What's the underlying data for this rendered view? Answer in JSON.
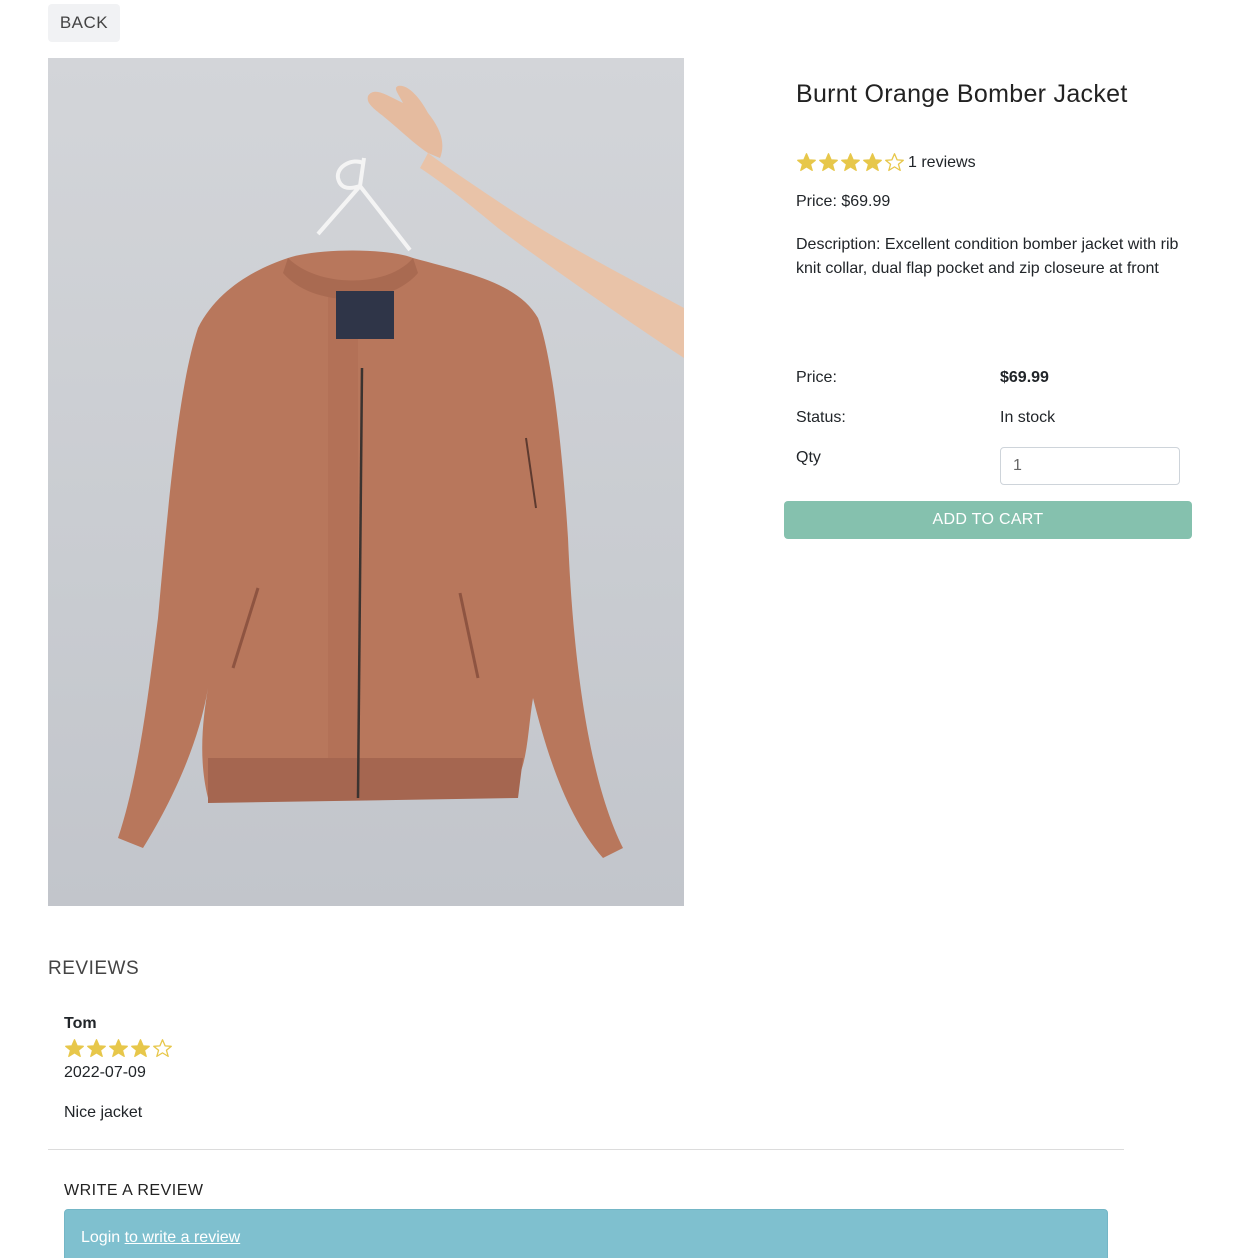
{
  "nav": {
    "back_label": "BACK"
  },
  "product": {
    "name": "Burnt Orange Bomber Jacket",
    "rating": 4,
    "rating_max": 5,
    "reviews_count_text": "1 reviews",
    "price_line": "Price: $69.99",
    "description": "Description: Excellent condition bomber jacket with rib knit collar, dual flap pocket and zip closeure at front",
    "image_icon": "product-photo"
  },
  "purchase": {
    "price_label": "Price:",
    "price_value": "$69.99",
    "status_label": "Status:",
    "status_value": "In stock",
    "qty_label": "Qty",
    "qty_value": "1",
    "add_to_cart_label": "ADD TO CART"
  },
  "reviews": {
    "heading": "REVIEWS",
    "items": [
      {
        "name": "Tom",
        "rating": 4,
        "date": "2022-07-09",
        "comment": "Nice jacket"
      }
    ],
    "write_heading": "WRITE A REVIEW",
    "login_text": "Login",
    "login_link_text": "to write a review"
  },
  "colors": {
    "star": "#e7c74a",
    "add_to_cart_bg": "#85c1ae",
    "alert_bg": "#7fc0cf",
    "jacket": "#b8775c"
  }
}
